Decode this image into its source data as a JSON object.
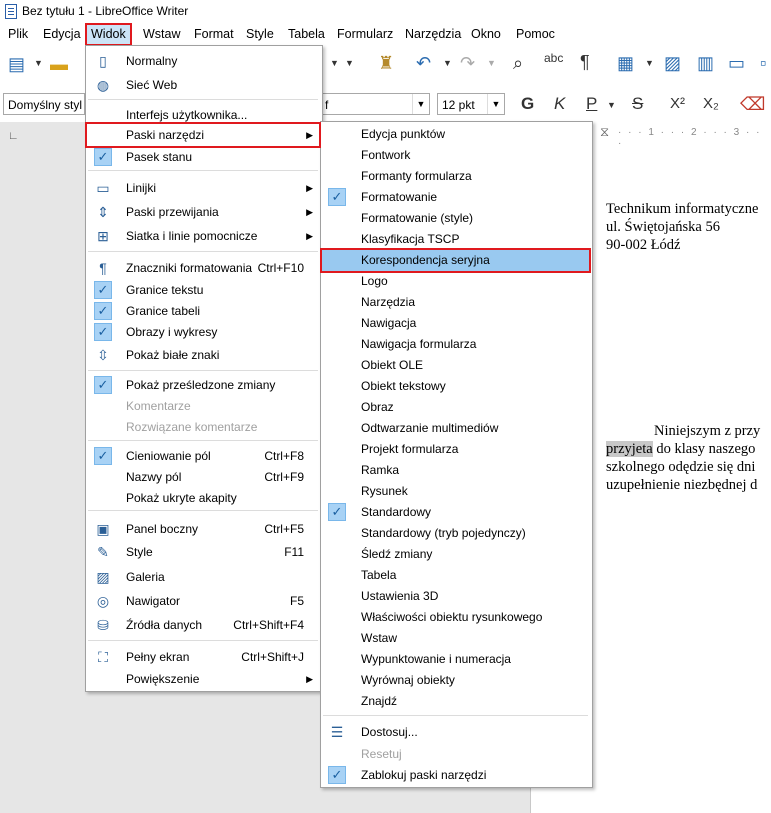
{
  "window": {
    "title": "Bez tytułu 1 - LibreOffice Writer"
  },
  "menubar": [
    "Plik",
    "Edycja",
    "Widok",
    "Wstaw",
    "Format",
    "Style",
    "Tabela",
    "Formularz",
    "Narzędzia",
    "Okno",
    "Pomoc"
  ],
  "toolbar2": {
    "paragraph_style": "Domyślny styl a",
    "font_name": "f",
    "font_size": "12 pkt",
    "bold": "G",
    "italic": "K",
    "underline": "P",
    "strike": "S",
    "superscript": "X²",
    "subscript": "X₂"
  },
  "widok_menu": [
    {
      "label": "Normalny",
      "shortcut": "",
      "state": "icon",
      "icon": "page-icon"
    },
    {
      "label": "Sieć Web",
      "shortcut": "",
      "state": "icon",
      "icon": "globe-icon"
    },
    {
      "label": "Interfejs użytkownika...",
      "shortcut": "",
      "state": ""
    },
    {
      "label": "Paski narzędzi",
      "shortcut": "",
      "state": "",
      "submenu": true
    },
    {
      "label": "Pasek stanu",
      "shortcut": "",
      "state": "checked"
    },
    {
      "label": "Linijki",
      "shortcut": "",
      "state": "icon",
      "icon": "ruler-icon",
      "submenu": true
    },
    {
      "label": "Paski przewijania",
      "shortcut": "",
      "state": "icon",
      "icon": "scrollbar-icon",
      "submenu": true
    },
    {
      "label": "Siatka i linie pomocnicze",
      "shortcut": "",
      "state": "icon",
      "icon": "grid-icon",
      "submenu": true
    },
    {
      "label": "Znaczniki formatowania",
      "shortcut": "Ctrl+F10",
      "state": "icon",
      "icon": "pilcrow-icon"
    },
    {
      "label": "Granice tekstu",
      "shortcut": "",
      "state": "checked"
    },
    {
      "label": "Granice tabeli",
      "shortcut": "",
      "state": "checked"
    },
    {
      "label": "Obrazy i wykresy",
      "shortcut": "",
      "state": "checked"
    },
    {
      "label": "Pokaż białe znaki",
      "shortcut": "",
      "state": "icon",
      "icon": "whitespace-icon"
    },
    {
      "label": "Pokaż prześledzone zmiany",
      "shortcut": "",
      "state": "checked"
    },
    {
      "label": "Komentarze",
      "shortcut": "",
      "state": "disabled"
    },
    {
      "label": "Rozwiązane komentarze",
      "shortcut": "",
      "state": "disabled"
    },
    {
      "label": "Cieniowanie pól",
      "shortcut": "Ctrl+F8",
      "state": "checked"
    },
    {
      "label": "Nazwy pól",
      "shortcut": "Ctrl+F9",
      "state": ""
    },
    {
      "label": "Pokaż ukryte akapity",
      "shortcut": "",
      "state": ""
    },
    {
      "label": "Panel boczny",
      "shortcut": "Ctrl+F5",
      "state": "icon",
      "icon": "sidebar-icon"
    },
    {
      "label": "Style",
      "shortcut": "F11",
      "state": "icon",
      "icon": "styles-icon"
    },
    {
      "label": "Galeria",
      "shortcut": "",
      "state": "icon",
      "icon": "gallery-icon"
    },
    {
      "label": "Nawigator",
      "shortcut": "F5",
      "state": "icon",
      "icon": "navigator-icon"
    },
    {
      "label": "Źródła danych",
      "shortcut": "Ctrl+Shift+F4",
      "state": "icon",
      "icon": "database-icon"
    },
    {
      "label": "Pełny ekran",
      "shortcut": "Ctrl+Shift+J",
      "state": "icon",
      "icon": "fullscreen-icon"
    },
    {
      "label": "Powiększenie",
      "shortcut": "",
      "state": "",
      "submenu": true
    }
  ],
  "toolbars_submenu": [
    {
      "label": "Edycja punktów",
      "state": ""
    },
    {
      "label": "Fontwork",
      "state": ""
    },
    {
      "label": "Formanty formularza",
      "state": ""
    },
    {
      "label": "Formatowanie",
      "state": "checked"
    },
    {
      "label": "Formatowanie (style)",
      "state": ""
    },
    {
      "label": "Klasyfikacja TSCP",
      "state": ""
    },
    {
      "label": "Korespondencja seryjna",
      "state": "highlighted"
    },
    {
      "label": "Logo",
      "state": ""
    },
    {
      "label": "Narzędzia",
      "state": ""
    },
    {
      "label": "Nawigacja",
      "state": ""
    },
    {
      "label": "Nawigacja formularza",
      "state": ""
    },
    {
      "label": "Obiekt OLE",
      "state": ""
    },
    {
      "label": "Obiekt tekstowy",
      "state": ""
    },
    {
      "label": "Obraz",
      "state": ""
    },
    {
      "label": "Odtwarzanie multimediów",
      "state": ""
    },
    {
      "label": "Projekt formularza",
      "state": ""
    },
    {
      "label": "Ramka",
      "state": ""
    },
    {
      "label": "Rysunek",
      "state": ""
    },
    {
      "label": "Standardowy",
      "state": "checked"
    },
    {
      "label": "Standardowy (tryb pojedynczy)",
      "state": ""
    },
    {
      "label": "Śledź zmiany",
      "state": ""
    },
    {
      "label": "Tabela",
      "state": ""
    },
    {
      "label": "Ustawienia 3D",
      "state": ""
    },
    {
      "label": "Właściwości obiektu rysunkowego",
      "state": ""
    },
    {
      "label": "Wstaw",
      "state": ""
    },
    {
      "label": "Wypunktowanie i numeracja",
      "state": ""
    },
    {
      "label": "Wyrównaj obiekty",
      "state": ""
    },
    {
      "label": "Znajdź",
      "state": ""
    },
    {
      "label": "Dostosuj...",
      "state": "icon",
      "icon": "customize-icon"
    },
    {
      "label": "Resetuj",
      "state": "disabled"
    },
    {
      "label": "Zablokuj paski narzędzi",
      "state": "checked"
    }
  ],
  "document": {
    "lines": [
      "Technikum informatyczne",
      "ul. Świętojańska 56",
      "90-002 Łódź"
    ],
    "para": [
      "Niniejszym z przy",
      "przyjeta do klasy naszego",
      "szkolnego odędzie się dni",
      "uzupełnienie niezbędnej d"
    ]
  }
}
